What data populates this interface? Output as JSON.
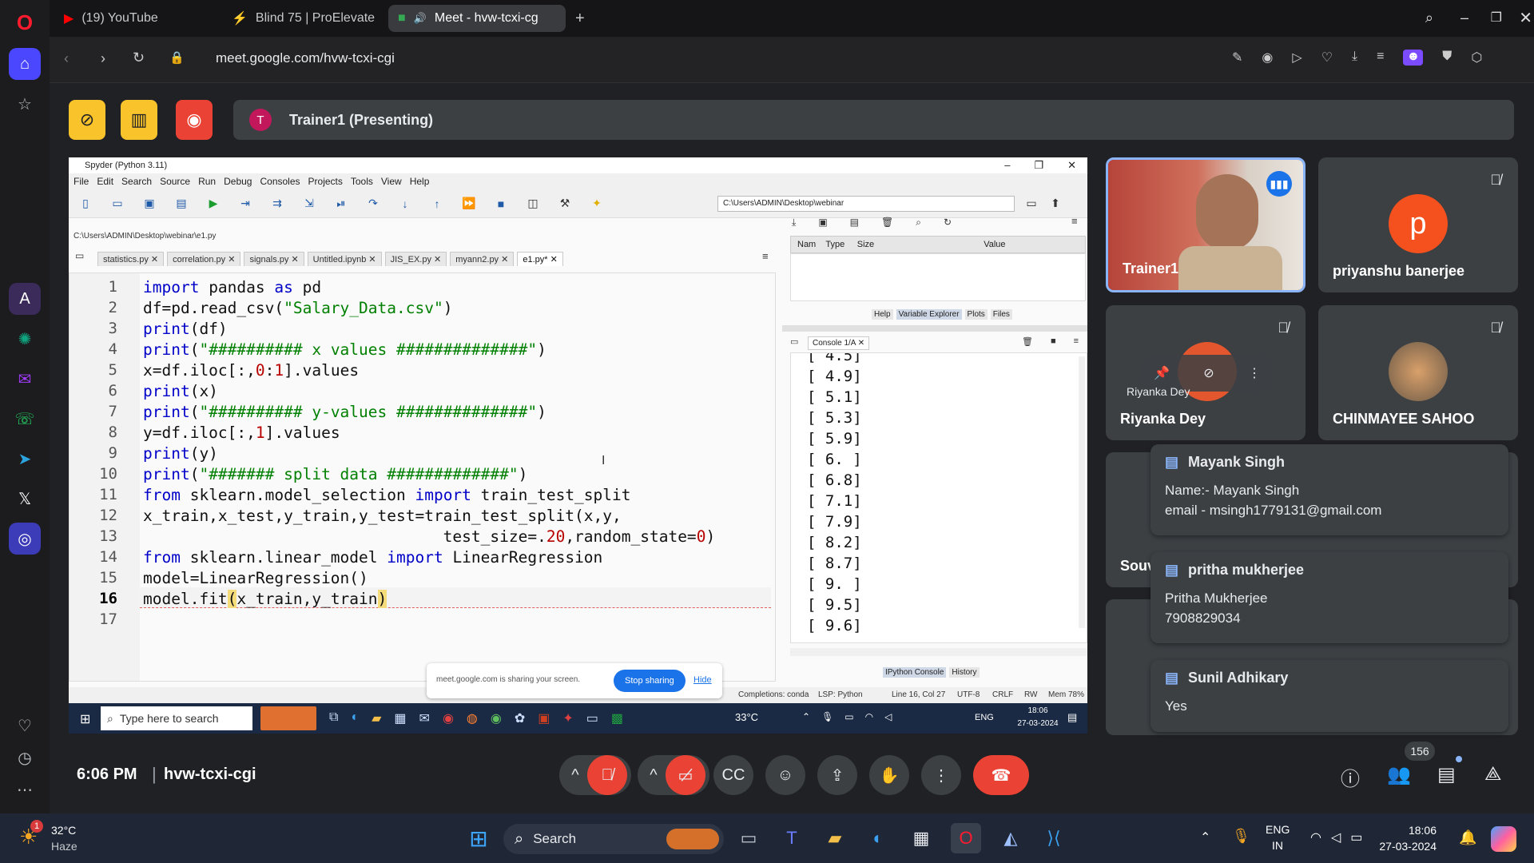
{
  "browser": {
    "tabs": [
      {
        "label": "(19) YouTube"
      },
      {
        "label": "Blind 75 | ProElevate"
      },
      {
        "label": "Meet - hvw-tcxi-cg"
      }
    ],
    "url": "meet.google.com/hvw-tcxi-cgi"
  },
  "meet": {
    "presenter_initial": "T",
    "presenter_label": "Trainer1 (Presenting)",
    "meeting_time": "6:06 PM",
    "meeting_code": "hvw-tcxi-cgi",
    "participant_count": "156",
    "tiles": [
      {
        "name": "Trainer1"
      },
      {
        "name": "priyanshu banerjee",
        "initial": "p"
      },
      {
        "name": "Riyanka Dey",
        "overlay_label": "Riyanka Dey"
      },
      {
        "name": "CHINMAYEE SAHOO"
      },
      {
        "name": "Souv"
      }
    ],
    "chat": [
      {
        "sender": "Mayank Singh",
        "lines": [
          "Name:- Mayank Singh",
          "email - msingh1779131@gmail.com"
        ]
      },
      {
        "sender": "pritha mukherjee",
        "lines": [
          "Pritha Mukherjee",
          "7908829034"
        ]
      },
      {
        "sender": "Sunil Adhikary",
        "lines": [
          "Yes"
        ]
      }
    ]
  },
  "spyder": {
    "title": "Spyder (Python 3.11)",
    "menu": [
      "File",
      "Edit",
      "Search",
      "Source",
      "Run",
      "Debug",
      "Consoles",
      "Projects",
      "Tools",
      "View",
      "Help"
    ],
    "working_dir": "C:\\Users\\ADMIN\\Desktop\\webinar",
    "file_path": "C:\\Users\\ADMIN\\Desktop\\webinar\\e1.py",
    "editor_tabs": [
      "statistics.py",
      "correlation.py",
      "signals.py",
      "Untitled.ipynb",
      "JIS_EX.py",
      "myann2.py",
      "e1.py*"
    ],
    "var_headers": [
      "Nam",
      "Type",
      "Size",
      "Value"
    ],
    "pane_tabs": [
      "Help",
      "Variable Explorer",
      "Plots",
      "Files"
    ],
    "console_tab": "Console 1/A",
    "console_lines": [
      "[ 4.5]",
      "[ 4.9]",
      "[ 5.1]",
      "[ 5.3]",
      "[ 5.9]",
      "[ 6. ]",
      "[ 6.8]",
      "[ 7.1]",
      "[ 7.9]",
      "[ 8.2]",
      "[ 8.7]",
      "[ 9. ]",
      "[ 9.5]",
      "[ 9.6]"
    ],
    "console_bottom_tabs": [
      "IPython Console",
      "History"
    ],
    "status_items": [
      "Completions: conda",
      "LSP: Python",
      "Line 16, Col 27",
      "UTF-8",
      "CRLF",
      "RW",
      "Mem 78%"
    ],
    "share_bar": {
      "text": "meet.google.com is sharing your screen.",
      "stop": "Stop sharing",
      "hide": "Hide"
    }
  },
  "inner_taskbar": {
    "search_placeholder": "Type here to search",
    "temp": "33°C",
    "lang": "ENG",
    "time": "18:06",
    "date": "27-03-2024"
  },
  "os_taskbar": {
    "weather_temp": "32°C",
    "weather_desc": "Haze",
    "search_label": "Search",
    "lang_top": "ENG",
    "lang_bottom": "IN",
    "time": "18:06",
    "date": "27-03-2024",
    "notify_badge": "1"
  },
  "colors": {
    "end_call": "#ea4335",
    "accent": "#8ab4f8",
    "opera_red": "#ff1b2d",
    "record": "#ea4335",
    "presenting_yellow": "#f9c32b"
  }
}
